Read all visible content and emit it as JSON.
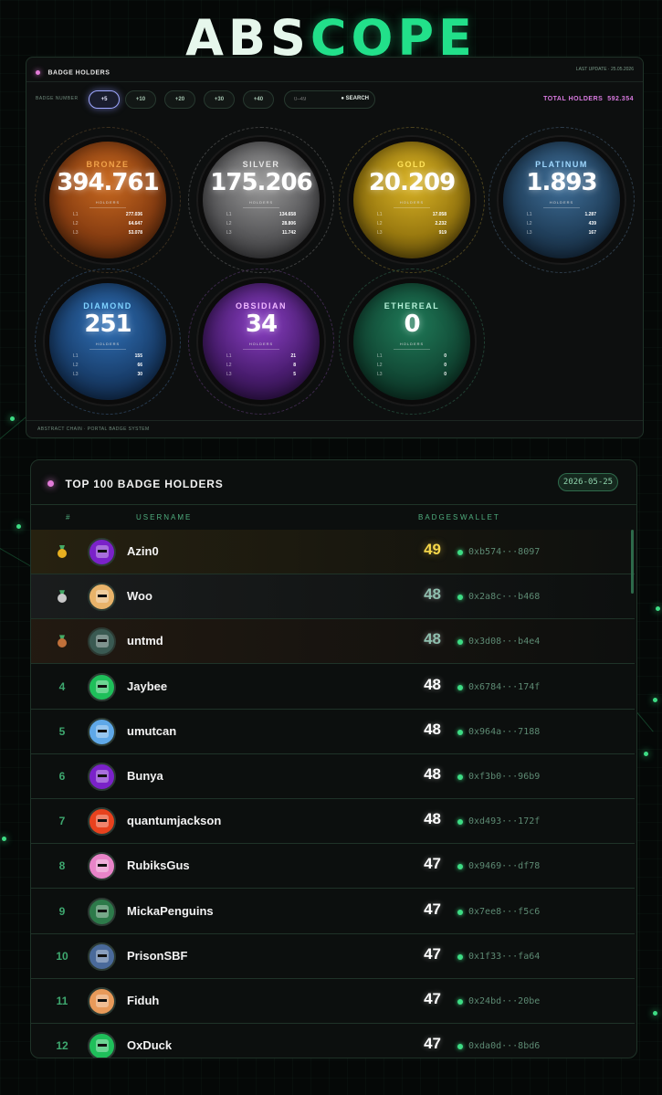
{
  "brand": {
    "part1": "ABS",
    "part2": "COPE"
  },
  "badge_panel": {
    "title": "BADGE HOLDERS",
    "last_update": "LAST UPDATE · 25.05.2026",
    "badge_number_label": "BADGE NUMBER",
    "filters": [
      "+5",
      "+10",
      "+20",
      "+30",
      "+40"
    ],
    "active_filter": "+5",
    "range_placeholder": "0–49",
    "search_label": "SEARCH",
    "total_label": "TOTAL HOLDERS",
    "total_value": "592.354",
    "holders_label": "HOLDERS",
    "footer": "ABSTRACT CHAIN · PORTAL BADGE SYSTEM",
    "tiers": [
      {
        "name": "BRONZE",
        "count": "394.761",
        "levels": [
          [
            "L1",
            "277.036"
          ],
          [
            "L2",
            "64.647"
          ],
          [
            "L3",
            "53.078"
          ]
        ],
        "color": "#f0a24a"
      },
      {
        "name": "SILVER",
        "count": "175.206",
        "levels": [
          [
            "L1",
            "134.658"
          ],
          [
            "L2",
            "28.806"
          ],
          [
            "L3",
            "11.742"
          ]
        ],
        "color": "#e6e6e6"
      },
      {
        "name": "GOLD",
        "count": "20.209",
        "levels": [
          [
            "L1",
            "17.058"
          ],
          [
            "L2",
            "2.232"
          ],
          [
            "L3",
            "919"
          ]
        ],
        "color": "#ffe35a"
      },
      {
        "name": "PLATINUM",
        "count": "1.893",
        "levels": [
          [
            "L1",
            "1.287"
          ],
          [
            "L2",
            "439"
          ],
          [
            "L3",
            "167"
          ]
        ],
        "color": "#9fd8ff"
      },
      {
        "name": "DIAMOND",
        "count": "251",
        "levels": [
          [
            "L1",
            "155"
          ],
          [
            "L2",
            "66"
          ],
          [
            "L3",
            "30"
          ]
        ],
        "color": "#7fd2ff"
      },
      {
        "name": "OBSIDIAN",
        "count": "34",
        "levels": [
          [
            "L1",
            "21"
          ],
          [
            "L2",
            "8"
          ],
          [
            "L3",
            "5"
          ]
        ],
        "color": "#f0b8ff"
      },
      {
        "name": "ETHEREAL",
        "count": "0",
        "levels": [
          [
            "L1",
            "0"
          ],
          [
            "L2",
            "0"
          ],
          [
            "L3",
            "0"
          ]
        ],
        "color": "#b5f0d8"
      }
    ]
  },
  "leaderboard": {
    "title": "TOP 100 BADGE HOLDERS",
    "date": "2026-05-25",
    "columns": {
      "rank": "#",
      "username": "USERNAME",
      "badges": "BADGES",
      "wallet": "WALLET"
    },
    "rows": [
      {
        "rank": "1",
        "medal": "gold",
        "username": "Azin0",
        "badges": "49",
        "wallet": "0xb574···8097",
        "avatar_color": "#7a22c9"
      },
      {
        "rank": "2",
        "medal": "silver",
        "username": "Woo",
        "badges": "48",
        "wallet": "0x2a8c···b468",
        "avatar_color": "#e8b36a"
      },
      {
        "rank": "3",
        "medal": "bronze",
        "username": "untmd",
        "badges": "48",
        "wallet": "0x3d08···b4e4",
        "avatar_color": "#3a5a52"
      },
      {
        "rank": "4",
        "medal": "",
        "username": "Jaybee",
        "badges": "48",
        "wallet": "0x6784···174f",
        "avatar_color": "#1fbf5a"
      },
      {
        "rank": "5",
        "medal": "",
        "username": "umutcan",
        "badges": "48",
        "wallet": "0x964a···7188",
        "avatar_color": "#5fa8e8"
      },
      {
        "rank": "6",
        "medal": "",
        "username": "Bunya",
        "badges": "48",
        "wallet": "0xf3b0···96b9",
        "avatar_color": "#7a22c9"
      },
      {
        "rank": "7",
        "medal": "",
        "username": "quantumjackson",
        "badges": "48",
        "wallet": "0xd493···172f",
        "avatar_color": "#e8421e"
      },
      {
        "rank": "8",
        "medal": "",
        "username": "RubiksGus",
        "badges": "47",
        "wallet": "0x9469···df78",
        "avatar_color": "#e884c8"
      },
      {
        "rank": "9",
        "medal": "",
        "username": "MickaPenguins",
        "badges": "47",
        "wallet": "0x7ee8···f5c6",
        "avatar_color": "#2d7a4a"
      },
      {
        "rank": "10",
        "medal": "",
        "username": "PrisonSBF",
        "badges": "47",
        "wallet": "0x1f33···fa64",
        "avatar_color": "#4a6a9a"
      },
      {
        "rank": "11",
        "medal": "",
        "username": "Fiduh",
        "badges": "47",
        "wallet": "0x24bd···20be",
        "avatar_color": "#e89a5a"
      },
      {
        "rank": "12",
        "medal": "",
        "username": "OxDuck",
        "badges": "47",
        "wallet": "0xda0d···8bd6",
        "avatar_color": "#1fbf5a"
      }
    ]
  }
}
